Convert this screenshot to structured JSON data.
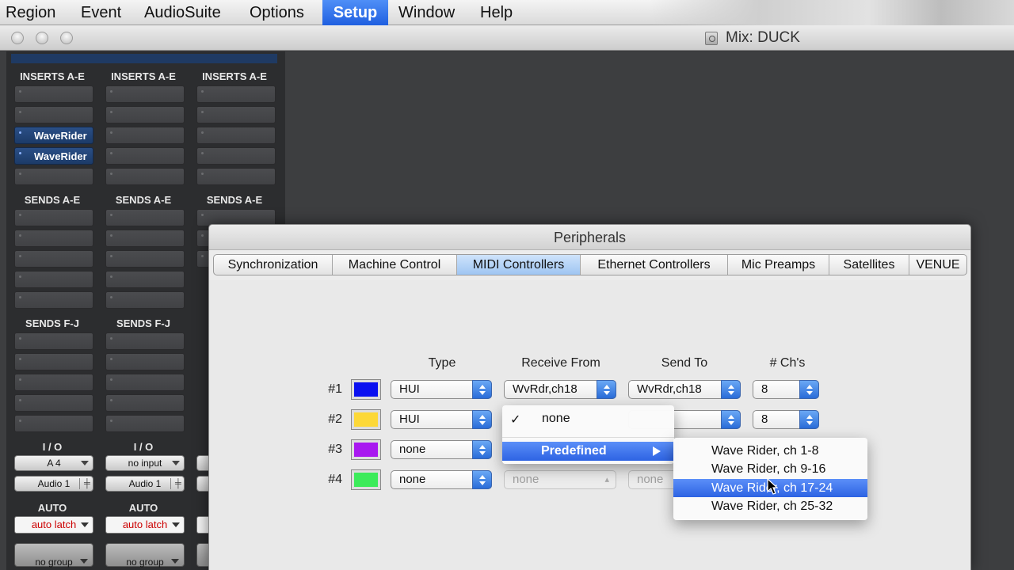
{
  "menubar": {
    "items": [
      {
        "label": "Region",
        "active": false
      },
      {
        "label": "Event",
        "active": false
      },
      {
        "label": "AudioSuite",
        "active": false
      },
      {
        "label": "Options",
        "active": false
      },
      {
        "label": "Setup",
        "active": true
      },
      {
        "label": "Window",
        "active": false
      },
      {
        "label": "Help",
        "active": false
      }
    ]
  },
  "mix_window": {
    "title": "Mix: DUCK",
    "strips": [
      {
        "inserts_label": "INSERTS A-E",
        "inserts": [
          "",
          "",
          "WaveRider",
          "WaveRider",
          ""
        ],
        "sends_ae_label": "SENDS A-E",
        "sends_fj_label": "SENDS F-J",
        "io_label": "I / O",
        "input": "A 4",
        "output": "Audio 1",
        "auto_label": "AUTO",
        "auto_mode": "auto latch",
        "group": "no group"
      },
      {
        "inserts_label": "INSERTS A-E",
        "inserts": [
          "",
          "",
          "",
          "",
          ""
        ],
        "sends_ae_label": "SENDS A-E",
        "sends_fj_label": "SENDS F-J",
        "io_label": "I / O",
        "input": "no input",
        "output": "Audio 1",
        "auto_label": "AUTO",
        "auto_mode": "auto latch",
        "group": "no group"
      },
      {
        "inserts_label": "INSERTS A-E",
        "inserts": [
          "",
          "",
          "",
          "",
          ""
        ],
        "sends_ae_label": "SENDS A-E",
        "sends_fj_label": "",
        "io_label": "",
        "input": "",
        "output": "",
        "auto_label": "",
        "auto_mode": "",
        "group": ""
      }
    ]
  },
  "dialog": {
    "title": "Peripherals",
    "tabs": [
      {
        "label": "Synchronization",
        "active": false
      },
      {
        "label": "Machine Control",
        "active": false
      },
      {
        "label": "MIDI Controllers",
        "active": true
      },
      {
        "label": "Ethernet Controllers",
        "active": false
      },
      {
        "label": "Mic Preamps",
        "active": false
      },
      {
        "label": "Satellites",
        "active": false
      },
      {
        "label": "VENUE",
        "active": false
      }
    ],
    "columns": {
      "type": "Type",
      "receive_from": "Receive From",
      "send_to": "Send To",
      "channels": "# Ch's"
    },
    "rows": [
      {
        "label": "#1",
        "color": "#0a10f0",
        "type": "HUI",
        "receive_from": "WvRdr,ch18",
        "send_to": "WvRdr,ch18",
        "channels": "8"
      },
      {
        "label": "#2",
        "color": "#fcd838",
        "type": "HUI",
        "receive_from": "",
        "send_to": "",
        "channels": "8"
      },
      {
        "label": "#3",
        "color": "#a818f0",
        "type": "none",
        "receive_from": "",
        "send_to": "",
        "channels": ""
      },
      {
        "label": "#4",
        "color": "#3ceb5a",
        "type": "none",
        "receive_from": "none",
        "send_to": "none",
        "channels": ""
      }
    ]
  },
  "receive_menu": {
    "check": "✓",
    "none_label": "none",
    "predefined_label": "Predefined"
  },
  "predefined_submenu": {
    "items": [
      {
        "label": "Wave Rider, ch 1-8",
        "highlighted": false
      },
      {
        "label": "Wave Rider, ch 9-16",
        "highlighted": false
      },
      {
        "label": "Wave Rider, ch 17-24",
        "highlighted": true
      },
      {
        "label": "Wave Rider, ch 25-32",
        "highlighted": false
      }
    ]
  }
}
